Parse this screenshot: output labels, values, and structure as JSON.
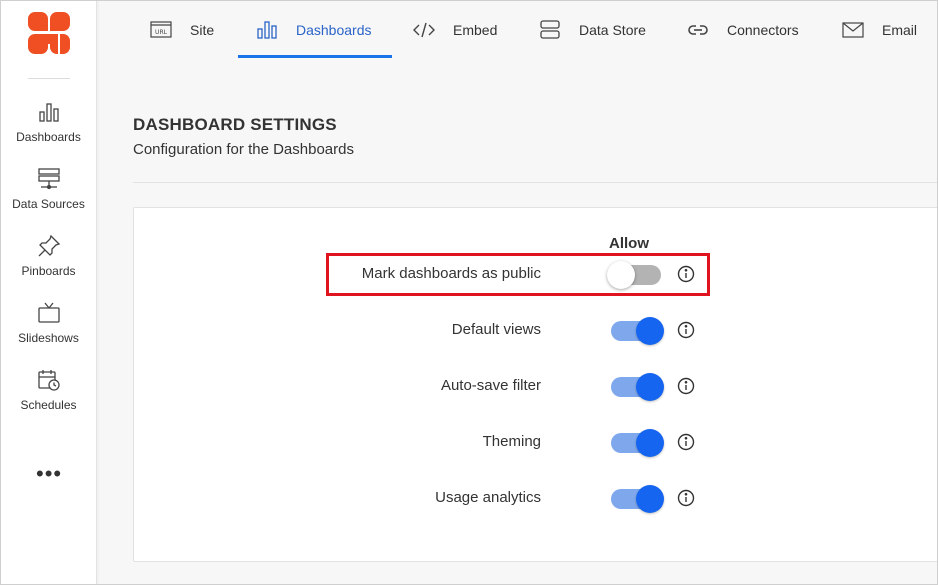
{
  "sidebar": {
    "items": [
      {
        "label": "Dashboards",
        "icon": "bar-chart-icon"
      },
      {
        "label": "Data Sources",
        "icon": "server-icon"
      },
      {
        "label": "Pinboards",
        "icon": "pin-icon"
      },
      {
        "label": "Slideshows",
        "icon": "tv-icon"
      },
      {
        "label": "Schedules",
        "icon": "calendar-clock-icon"
      }
    ],
    "more_label": "•••"
  },
  "tabs": [
    {
      "label": "Site",
      "icon": "url-icon",
      "active": false
    },
    {
      "label": "Dashboards",
      "icon": "bar-chart-icon",
      "active": true
    },
    {
      "label": "Embed",
      "icon": "code-icon",
      "active": false
    },
    {
      "label": "Data Store",
      "icon": "database-icon",
      "active": false
    },
    {
      "label": "Connectors",
      "icon": "link-icon",
      "active": false
    },
    {
      "label": "Email",
      "icon": "mail-icon",
      "active": false
    }
  ],
  "header": {
    "title": "DASHBOARD SETTINGS",
    "subtitle": "Configuration for the Dashboards"
  },
  "settings": {
    "column_label": "Allow",
    "rows": [
      {
        "label": "Mark dashboards as public",
        "enabled": false
      },
      {
        "label": "Default views",
        "enabled": true
      },
      {
        "label": "Auto-save filter",
        "enabled": true
      },
      {
        "label": "Theming",
        "enabled": true
      },
      {
        "label": "Usage analytics",
        "enabled": true
      }
    ]
  },
  "colors": {
    "accent": "#1a73e8",
    "logo": "#f04e23",
    "highlight": "#e0141e",
    "toggle_on": "#1565f0",
    "toggle_track_on": "#7ea7ec",
    "toggle_track_off": "#b3b3b3"
  }
}
